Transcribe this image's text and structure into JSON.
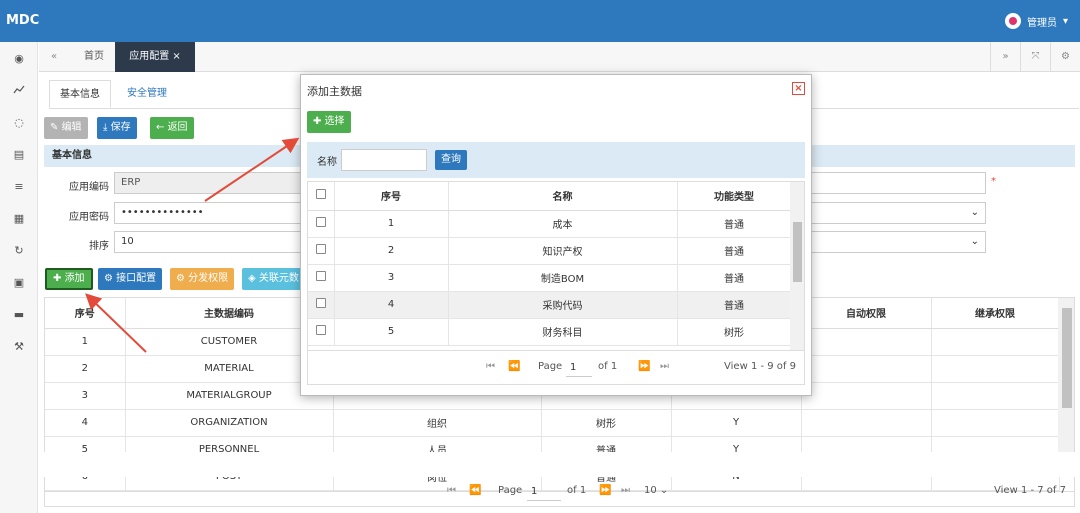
{
  "app": {
    "logo": "MDC",
    "user_name": "管理员"
  },
  "sidebar_icons": [
    "dashboard-icon",
    "chart-icon",
    "spinner-icon",
    "database-icon",
    "list-icon",
    "card-icon",
    "refresh-icon",
    "film-icon",
    "folder-icon",
    "wrench-icon"
  ],
  "tabs": {
    "home": "首页",
    "active": "应用配置"
  },
  "subtabs": [
    "基本信息",
    "安全管理"
  ],
  "toolbar": {
    "edit": "编辑",
    "save": "保存",
    "back": "返回"
  },
  "section_title": "基本信息",
  "form": {
    "code_label": "应用编码",
    "code_value": "ERP",
    "password_label": "应用密码",
    "password_value": "••••••••••••••",
    "order_label": "排序",
    "order_value": "10"
  },
  "action_buttons": {
    "add": "添加",
    "interface": "接口配置",
    "distribute": "分发权限",
    "related": "关联元数"
  },
  "main_table": {
    "headers": [
      "序号",
      "主数据编码",
      "",
      "",
      "",
      "自动权限",
      "继承权限"
    ],
    "rows": [
      [
        "1",
        "CUSTOMER",
        "",
        "",
        "",
        "",
        ""
      ],
      [
        "2",
        "MATERIAL",
        "",
        "",
        "",
        "",
        ""
      ],
      [
        "3",
        "MATERIALGROUP",
        "",
        "",
        "",
        "",
        ""
      ],
      [
        "4",
        "ORGANIZATION",
        "组织",
        "树形",
        "Y",
        "",
        ""
      ],
      [
        "5",
        "PERSONNEL",
        "人员",
        "普通",
        "Y",
        "",
        ""
      ],
      [
        "6",
        "POST",
        "岗位",
        "普通",
        "N",
        "",
        ""
      ]
    ]
  },
  "main_pager": {
    "page_label": "Page",
    "page_value": "1",
    "of_label": "of 1",
    "page_size": "10",
    "view": "View 1 - 7 of 7"
  },
  "modal": {
    "title": "添加主数据",
    "select_button": "选择",
    "search_label": "名称",
    "search_value": "",
    "query_button": "查询",
    "headers": [
      "序号",
      "名称",
      "功能类型"
    ],
    "rows": [
      [
        "1",
        "成本",
        "普通"
      ],
      [
        "2",
        "知识产权",
        "普通"
      ],
      [
        "3",
        "制造BOM",
        "普通"
      ],
      [
        "4",
        "采购代码",
        "普通"
      ],
      [
        "5",
        "财务科目",
        "树形"
      ]
    ],
    "pager": {
      "page_label": "Page",
      "page_value": "1",
      "of_label": "of 1",
      "view": "View 1 - 9 of 9"
    }
  },
  "colors": {
    "primary": "#2e79bd",
    "green": "#4cae4c",
    "orange": "#f0ad4e",
    "cyan": "#5bc0de",
    "annotation": "#e34a39"
  }
}
